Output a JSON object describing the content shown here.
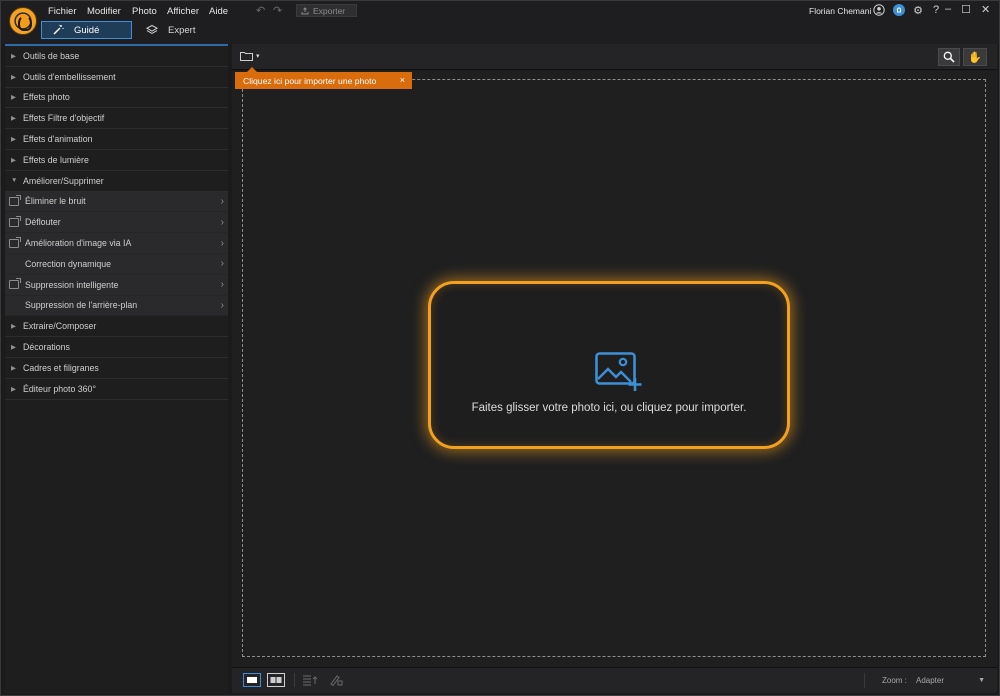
{
  "menu": [
    "Fichier",
    "Modifier",
    "Photo",
    "Afficher",
    "Aide"
  ],
  "toolbar": {
    "export_label": "Exporter"
  },
  "modes": {
    "guided": "Guidé",
    "expert": "Expert"
  },
  "user": {
    "name": "Florian Chemani"
  },
  "sidebar": {
    "categories_top": [
      "Outils de base",
      "Outils d'embellissement",
      "Effets photo",
      "Effets Filtre d'objectif",
      "Effets d'animation",
      "Effets de lumière"
    ],
    "expanded_category": "Améliorer/Supprimer",
    "subitems": [
      {
        "label": "Éliminer le bruit",
        "has_icon": true
      },
      {
        "label": "Déflouter",
        "has_icon": true
      },
      {
        "label": "Amélioration d'image via IA",
        "has_icon": true
      },
      {
        "label": "Correction dynamique",
        "has_icon": false
      },
      {
        "label": "Suppression intelligente",
        "has_icon": true
      },
      {
        "label": "Suppression de l'arrière-plan",
        "has_icon": false
      }
    ],
    "categories_bottom": [
      "Extraire/Composer",
      "Décorations",
      "Cadres et filigranes",
      "Éditeur photo 360°"
    ]
  },
  "canvas": {
    "tooltip": "Cliquez ici pour importer une photo",
    "tooltip_close": "×",
    "dropzone_text": "Faites glisser votre photo ici, ou cliquez pour importer."
  },
  "bottombar": {
    "zoom_label": "Zoom :",
    "zoom_value": "Adapter"
  },
  "colors": {
    "accent_orange": "#f2a01e",
    "accent_blue": "#3d8fd6",
    "tooltip_bg": "#d96c0d"
  }
}
